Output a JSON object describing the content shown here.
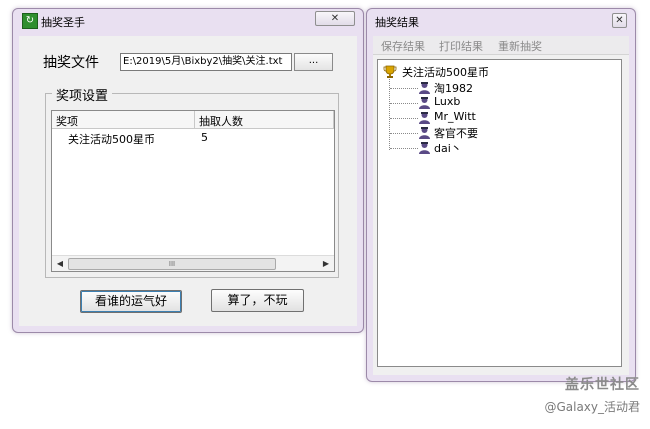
{
  "lottery_window": {
    "title": "抽奖圣手",
    "close_symbol": "✕",
    "file_label": "抽奖文件",
    "file_path": "E:\\2019\\5月\\Bixby2\\抽奖\\关注.txt",
    "browse_label": "...",
    "group_title": "奖项设置",
    "columns": [
      "奖项",
      "抽取人数"
    ],
    "rows": [
      {
        "prize": "关注活动500星币",
        "count": "5"
      }
    ],
    "scroll_thumb": "III",
    "scroll_left": "◀",
    "scroll_right": "▶",
    "draw_button": "看谁的运气好",
    "quit_button": "算了，不玩"
  },
  "results_window": {
    "title": "抽奖结果",
    "close_symbol": "✕",
    "toolbar": [
      "保存结果",
      "打印结果",
      "重新抽奖"
    ],
    "root": "关注活动500星币",
    "winners": [
      "淘1982",
      "Luxb",
      "Mr_Witt",
      "客官不要",
      "dai丶"
    ]
  },
  "watermark": {
    "site": "盖乐世社区",
    "author": "@Galaxy_活动君"
  },
  "colors": {
    "window_frame": "#e9e0f1",
    "trophy": "#d9a400",
    "user_icon": "#5a4a86"
  }
}
